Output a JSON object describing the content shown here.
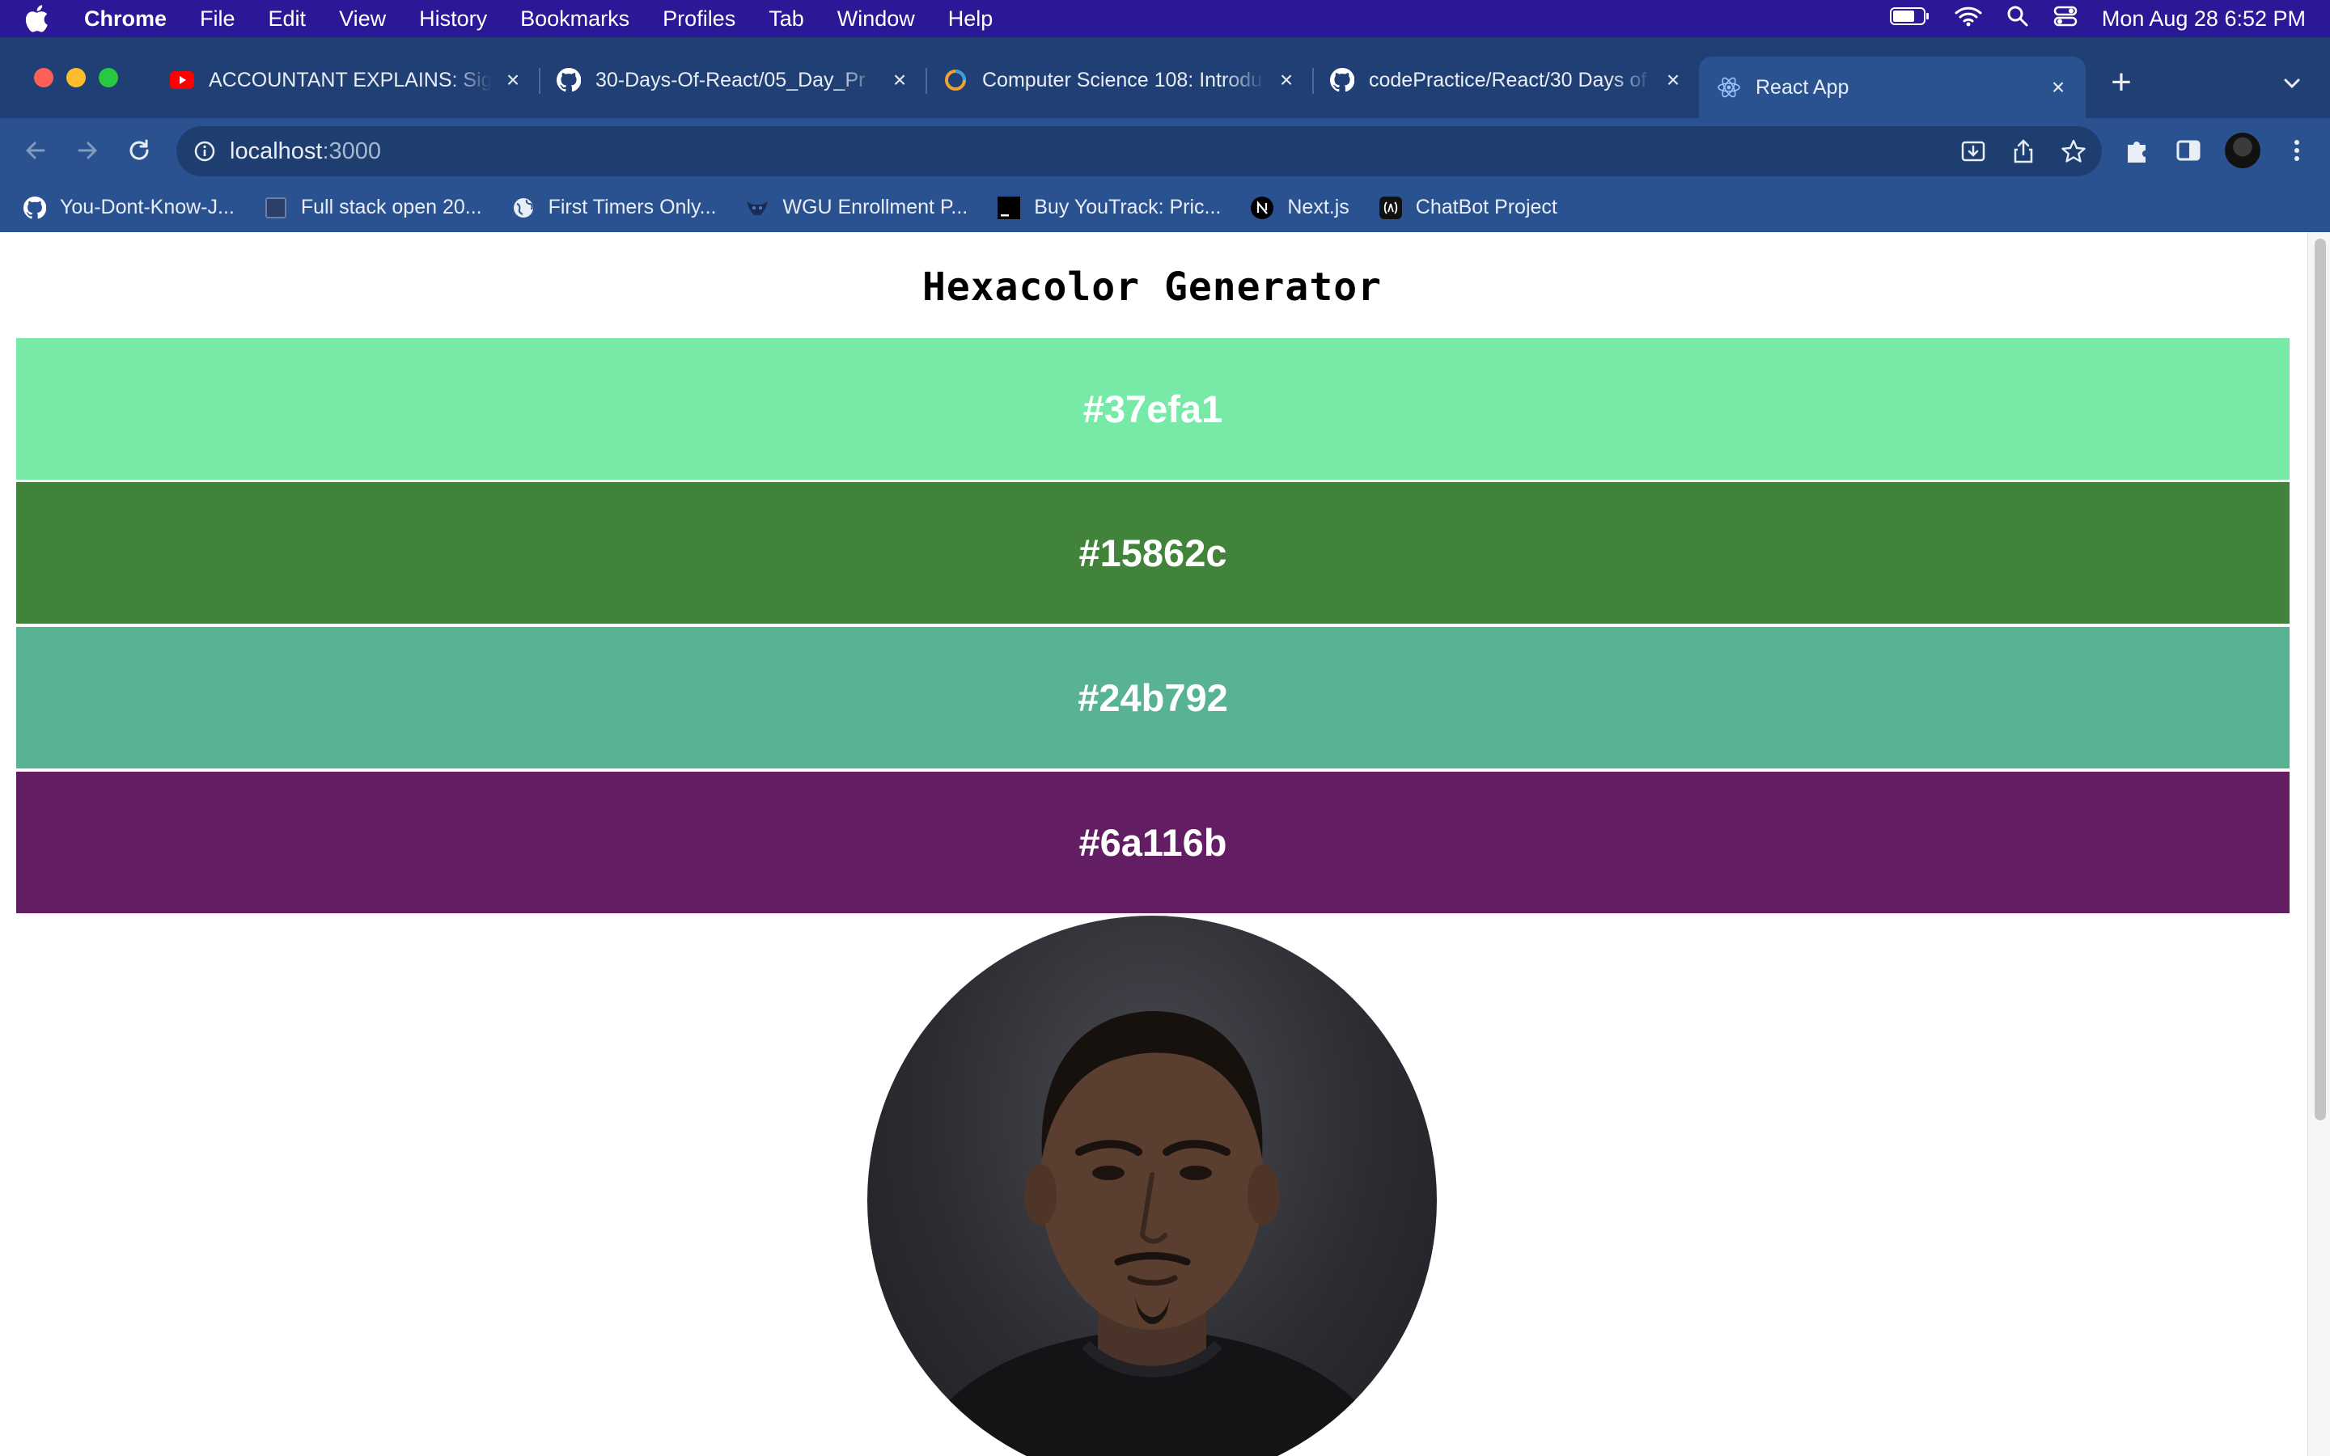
{
  "menubar": {
    "app": "Chrome",
    "items": [
      "File",
      "Edit",
      "View",
      "History",
      "Bookmarks",
      "Profiles",
      "Tab",
      "Window",
      "Help"
    ],
    "datetime": "Mon Aug 28  6:52 PM"
  },
  "tabs": [
    {
      "title": "ACCOUNTANT EXPLAINS: Sign",
      "icon": "youtube-icon"
    },
    {
      "title": "30-Days-Of-React/05_Day_Pr",
      "icon": "github-icon"
    },
    {
      "title": "Computer Science 108: Introdu",
      "icon": "study-icon"
    },
    {
      "title": "codePractice/React/30 Days of",
      "icon": "github-icon"
    },
    {
      "title": "React App",
      "icon": "react-icon",
      "active": true
    }
  ],
  "address": {
    "host": "localhost",
    "port": ":3000"
  },
  "bookmarks": [
    {
      "label": "You-Dont-Know-J...",
      "icon": "github-icon"
    },
    {
      "label": "Full stack open 20...",
      "icon": "square-icon"
    },
    {
      "label": "First Timers Only...",
      "icon": "globe-icon"
    },
    {
      "label": "WGU Enrollment P...",
      "icon": "owl-icon"
    },
    {
      "label": "Buy YouTrack: Pric...",
      "icon": "jetbrains-icon"
    },
    {
      "label": "Next.js",
      "icon": "nextjs-icon"
    },
    {
      "label": "ChatBot Project",
      "icon": "app-icon"
    }
  ],
  "page": {
    "title": "Hexacolor Generator",
    "colors": [
      {
        "hex": "#37efa1",
        "bg": "#77eaa8"
      },
      {
        "hex": "#15862c",
        "bg": "#41833a"
      },
      {
        "hex": "#24b792",
        "bg": "#57b391"
      },
      {
        "hex": "#6a116b",
        "bg": "#621d63"
      }
    ]
  }
}
